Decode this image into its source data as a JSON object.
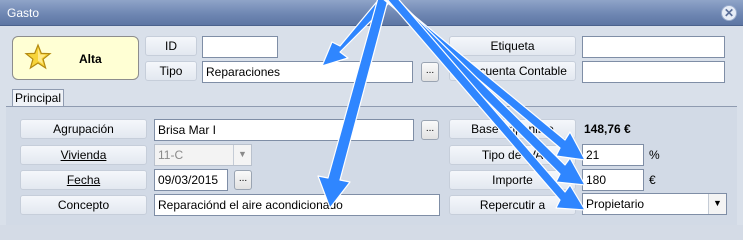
{
  "window": {
    "title": "Gasto",
    "close_glyph": "✕"
  },
  "header": {
    "alta_label": "Alta",
    "id_label": "ID",
    "id_value": "",
    "tipo_label": "Tipo",
    "tipo_value": "Reparaciones",
    "etiqueta_label": "Etiqueta",
    "etiqueta_value": "",
    "subcuenta_label": "Subcuenta Contable",
    "subcuenta_value": ""
  },
  "tabs": [
    {
      "label": "Principal",
      "active": true
    }
  ],
  "form": {
    "agrupacion_label": "Agrupación",
    "agrupacion_value": "Brisa Mar I",
    "vivienda_label": "Vivienda",
    "vivienda_value": "11-C",
    "fecha_label": "Fecha",
    "fecha_value": "09/03/2015",
    "concepto_label": "Concepto",
    "concepto_value": "Reparaciónd el aire acondicionado",
    "base_imponible_label": "Base Imponible",
    "base_imponible_value": "148,76 €",
    "tipo_iva_label": "Tipo de IVA",
    "tipo_iva_value": "21",
    "tipo_iva_unit": "%",
    "importe_label": "Importe",
    "importe_value": "180",
    "importe_unit": "€",
    "repercutir_label": "Repercutir a",
    "repercutir_value": "Propietario"
  },
  "glyphs": {
    "ellipsis": "...",
    "dropdown": "▼"
  },
  "colors": {
    "titlebar": "#6f87b3",
    "alta_bg": "#ffffd4",
    "annotation_arrow": "#2f86ff"
  },
  "icons": {
    "alta": "star-icon",
    "close": "close-icon"
  }
}
